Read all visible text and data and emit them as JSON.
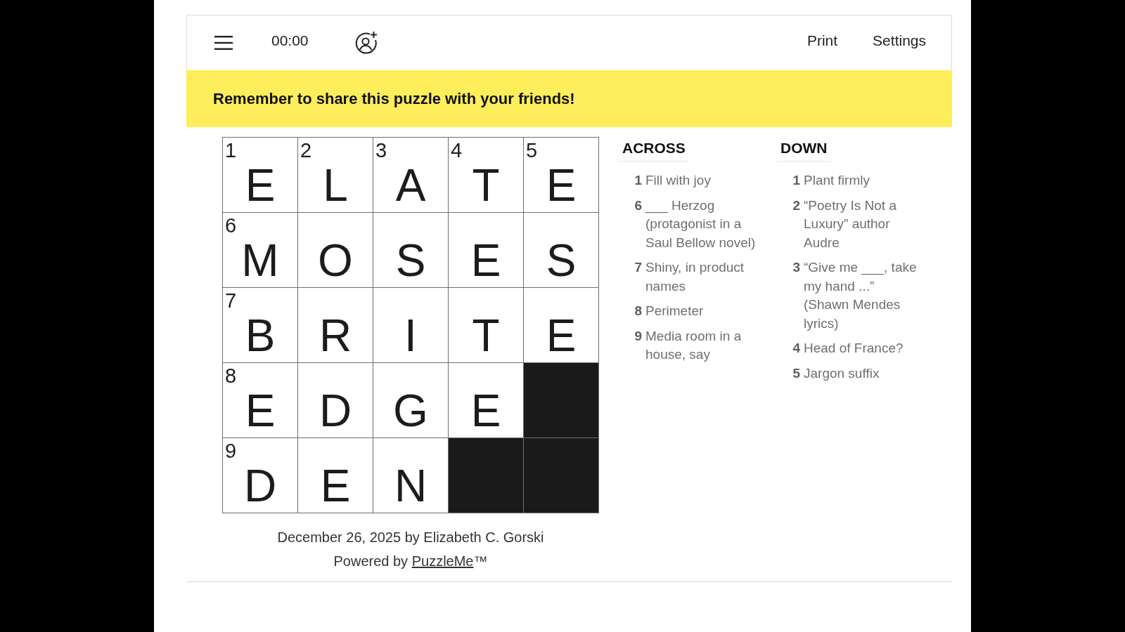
{
  "toolbar": {
    "timer": "00:00",
    "buttons": [
      "Print",
      "Settings"
    ]
  },
  "banner": {
    "text": "Remember to share this puzzle with your friends!"
  },
  "grid": {
    "rows": [
      [
        {
          "kind": "letter",
          "number": "1",
          "letter": "E"
        },
        {
          "kind": "letter",
          "number": "2",
          "letter": "L"
        },
        {
          "kind": "letter",
          "number": "3",
          "letter": "A"
        },
        {
          "kind": "letter",
          "number": "4",
          "letter": "T"
        },
        {
          "kind": "letter",
          "number": "5",
          "letter": "E"
        }
      ],
      [
        {
          "kind": "letter",
          "number": "6",
          "letter": "M"
        },
        {
          "kind": "letter",
          "letter": "O"
        },
        {
          "kind": "letter",
          "letter": "S"
        },
        {
          "kind": "letter",
          "letter": "E"
        },
        {
          "kind": "letter",
          "letter": "S"
        }
      ],
      [
        {
          "kind": "letter",
          "number": "7",
          "letter": "B"
        },
        {
          "kind": "letter",
          "letter": "R"
        },
        {
          "kind": "letter",
          "letter": "I"
        },
        {
          "kind": "letter",
          "letter": "T"
        },
        {
          "kind": "letter",
          "letter": "E"
        }
      ],
      [
        {
          "kind": "letter",
          "number": "8",
          "letter": "E"
        },
        {
          "kind": "letter",
          "letter": "D"
        },
        {
          "kind": "letter",
          "letter": "G"
        },
        {
          "kind": "letter",
          "letter": "E"
        },
        {
          "kind": "block"
        }
      ],
      [
        {
          "kind": "letter",
          "number": "9",
          "letter": "D"
        },
        {
          "kind": "letter",
          "letter": "E"
        },
        {
          "kind": "letter",
          "letter": "N"
        },
        {
          "kind": "block"
        },
        {
          "kind": "block"
        }
      ]
    ]
  },
  "clues": [
    {
      "heading": "ACROSS",
      "items": [
        {
          "number": "1",
          "text": "Fill with joy"
        },
        {
          "number": "6",
          "text": "___ Herzog (protagonist in a Saul Bellow novel)"
        },
        {
          "number": "7",
          "text": "Shiny, in product names"
        },
        {
          "number": "8",
          "text": "Perimeter"
        },
        {
          "number": "9",
          "text": "Media room in a house, say"
        }
      ]
    },
    {
      "heading": "DOWN",
      "items": [
        {
          "number": "1",
          "text": "Plant firmly"
        },
        {
          "number": "2",
          "text": "“Poetry Is Not a Luxury” author Audre"
        },
        {
          "number": "3",
          "text": "“Give me ___, take my hand ...” (Shawn Mendes lyrics)"
        },
        {
          "number": "4",
          "text": "Head of France?"
        },
        {
          "number": "5",
          "text": "Jargon suffix"
        }
      ]
    }
  ],
  "footer": {
    "byline": "December 26, 2025 by Elizabeth C. Gorski",
    "powered_by": {
      "text": "Powered by ",
      "link": "PuzzleMe",
      "suffix": "™"
    }
  }
}
